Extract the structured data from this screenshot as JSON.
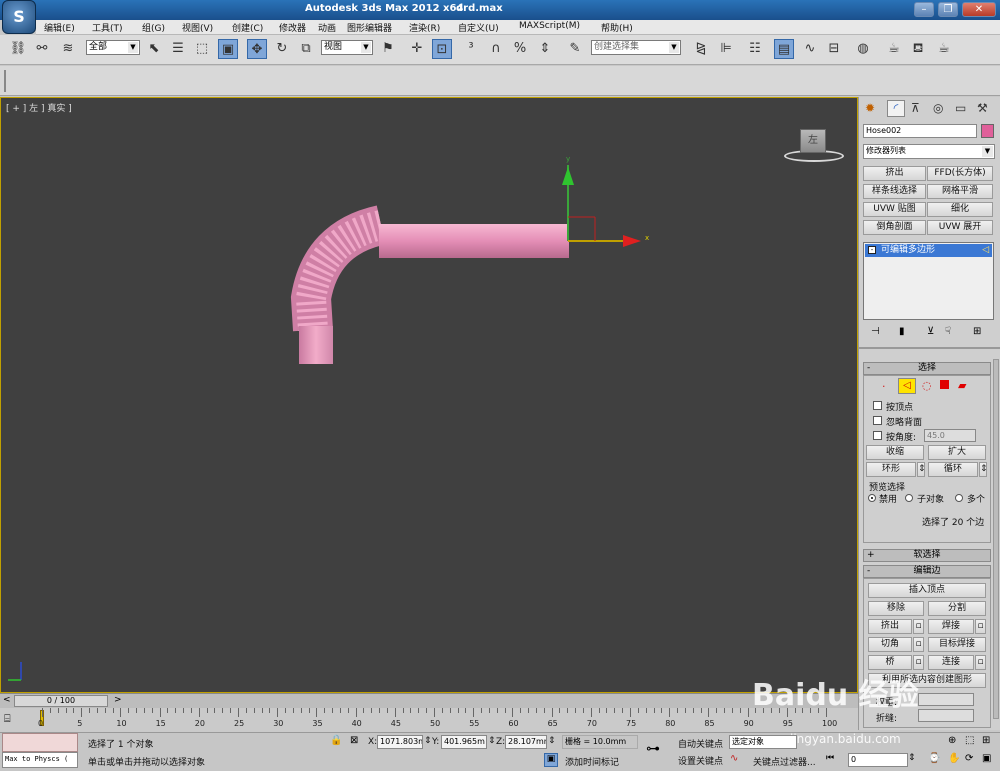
{
  "window": {
    "app_title": "Autodesk 3ds Max  2012 x64",
    "file_name": "drd.max",
    "app_logo": "S"
  },
  "menu": [
    "编辑(E)",
    "工具(T)",
    "组(G)",
    "视图(V)",
    "创建(C)",
    "修改器",
    "动画",
    "图形编辑器",
    "渲染(R)",
    "自定义(U)",
    "MAXScript(M)",
    "帮助(H)"
  ],
  "toolbar": {
    "filter_value": "全部",
    "refcoord_value": "视图",
    "selection_set_placeholder": "创建选择集"
  },
  "viewport": {
    "label": "[ + ] 左 ] 真实 ]",
    "viewcube_label": "左",
    "axis_x": "x",
    "axis_y": "y"
  },
  "panel": {
    "object_name": "Hose002",
    "object_color": "#e0609a",
    "modifier_list_label": "修改器列表",
    "modifier_buttons": [
      "挤出",
      "FFD(长方体)",
      "样条线选择",
      "网格平滑",
      "UVW 贴图",
      "细化",
      "倒角剖面",
      "UVW 展开"
    ],
    "stack_item": "可编辑多边形",
    "selection": {
      "title": "选择",
      "by_vertex": "按顶点",
      "ignore_backface": "忽略背面",
      "by_angle": "按角度:",
      "angle_value": "45.0",
      "shrink": "收缩",
      "grow": "扩大",
      "ring": "环形",
      "loop": "循环",
      "preview_title": "预览选择",
      "preview_options": [
        "禁用",
        "子对象",
        "多个"
      ],
      "status": "选择了 20 个边"
    },
    "soft_selection_title": "软选择",
    "edit_edges": {
      "title": "编辑边",
      "insert_vertex": "插入顶点",
      "remove": "移除",
      "split": "分割",
      "extrude": "挤出",
      "weld": "焊接",
      "chamfer": "切角",
      "target_weld": "目标焊接",
      "bridge": "桥",
      "connect": "连接",
      "create_shape": "利用所选内容创建图形",
      "weight_label": "权重:",
      "crease_label": "折缝:"
    }
  },
  "timeline": {
    "frame_display": "0 / 100",
    "ticks": [
      0,
      5,
      10,
      15,
      20,
      25,
      30,
      35,
      40,
      45,
      50,
      55,
      60,
      65,
      70,
      75,
      80,
      85,
      90,
      95,
      100
    ]
  },
  "status": {
    "script_listener": "Max to Physcs (",
    "selected_text": "选择了 1 个对象",
    "prompt_text": "单击或单击并拖动以选择对象",
    "x_label": "X:",
    "x_value": "1071.803m",
    "y_label": "Y:",
    "y_value": "401.965m",
    "z_label": "Z:",
    "z_value": "28.107mm",
    "grid_text": "栅格 = 10.0mm",
    "add_time_tag": "添加时间标记",
    "auto_key": "自动关键点",
    "set_key": "设置关键点",
    "selected_objects": "选定对象",
    "key_filters": "关键点过滤器...",
    "frame_value": "0"
  },
  "watermark": "Baidu 经验",
  "watermark_url": "jingyan.baidu.com"
}
